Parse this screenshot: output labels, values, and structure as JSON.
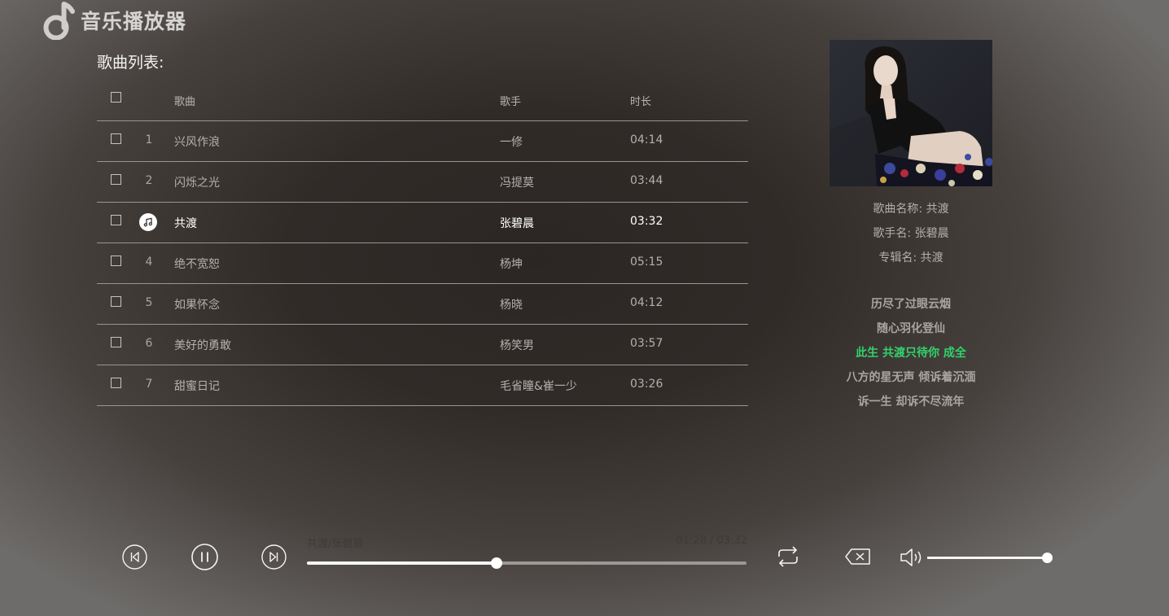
{
  "app": {
    "title": "音乐播放器"
  },
  "playlist": {
    "title": "歌曲列表:",
    "columns": {
      "song": "歌曲",
      "artist": "歌手",
      "duration": "时长"
    },
    "rows": [
      {
        "num": "1",
        "song": "兴风作浪",
        "artist": "一修",
        "duration": "04:14",
        "active": false
      },
      {
        "num": "2",
        "song": "闪烁之光",
        "artist": "冯提莫",
        "duration": "03:44",
        "active": false
      },
      {
        "num": "3",
        "song": "共渡",
        "artist": "张碧晨",
        "duration": "03:32",
        "active": true
      },
      {
        "num": "4",
        "song": "绝不宽恕",
        "artist": "杨坤",
        "duration": "05:15",
        "active": false
      },
      {
        "num": "5",
        "song": "如果怀念",
        "artist": "杨晓",
        "duration": "04:12",
        "active": false
      },
      {
        "num": "6",
        "song": "美好的勇敢",
        "artist": "杨笑男",
        "duration": "03:57",
        "active": false
      },
      {
        "num": "7",
        "song": "甜蜜日记",
        "artist": "毛省瞳&崔一少",
        "duration": "03:26",
        "active": false
      }
    ]
  },
  "song_info": {
    "song_line": "歌曲名称:  共渡",
    "artist_line": "歌手名:  张碧晨",
    "album_line": "专辑名:  共渡"
  },
  "lyrics": {
    "lines": [
      "历尽了过眼云烟",
      "随心羽化登仙",
      "此生 共渡只待你 成全",
      "八方的星无声 倾诉着沉湎",
      "诉一生 却诉不尽流年"
    ],
    "current_index": 2
  },
  "player": {
    "now_playing": "共渡/张碧晨",
    "time": "01:28 / 03:32",
    "progress": 0.4307,
    "volume": 1.0
  },
  "icons": {
    "logo": "music-note-icon",
    "prev": "skip-previous-icon",
    "pause": "pause-icon",
    "next": "skip-next-icon",
    "repeat": "repeat-icon",
    "delete": "backspace-icon",
    "volume": "volume-icon",
    "playing": "music-note-icon"
  },
  "colors": {
    "lyric_current": "#33d16c",
    "text_active": "#ffffff"
  }
}
